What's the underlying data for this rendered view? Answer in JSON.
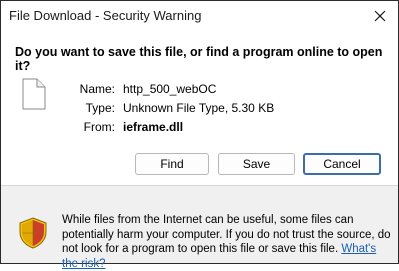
{
  "window": {
    "title": "File Download - Security Warning"
  },
  "dialog": {
    "question": "Do you want to save this file, or find a program online to open it?",
    "file_icon": "document-icon",
    "name_label": "Name:",
    "name_value": "http_500_webOC",
    "type_label": "Type:",
    "type_value": "Unknown File Type, 5.30 KB",
    "from_label": "From:",
    "from_value": "ieframe.dll"
  },
  "buttons": {
    "find": "Find",
    "save": "Save",
    "cancel": "Cancel"
  },
  "footer": {
    "icon": "security-shield-icon",
    "warning_text": "While files from the Internet can be useful, some files can potentially harm your computer. If you do not trust the source, do not look for a program to open this file or save this file.",
    "risk_link": "What's the risk?"
  },
  "colors": {
    "default_button_border": "#3b6ea8",
    "link": "#1c5fb0",
    "footer_bg": "#f0f0f0",
    "shield_yellow": "#f2c21b",
    "shield_red": "#c9302c"
  }
}
